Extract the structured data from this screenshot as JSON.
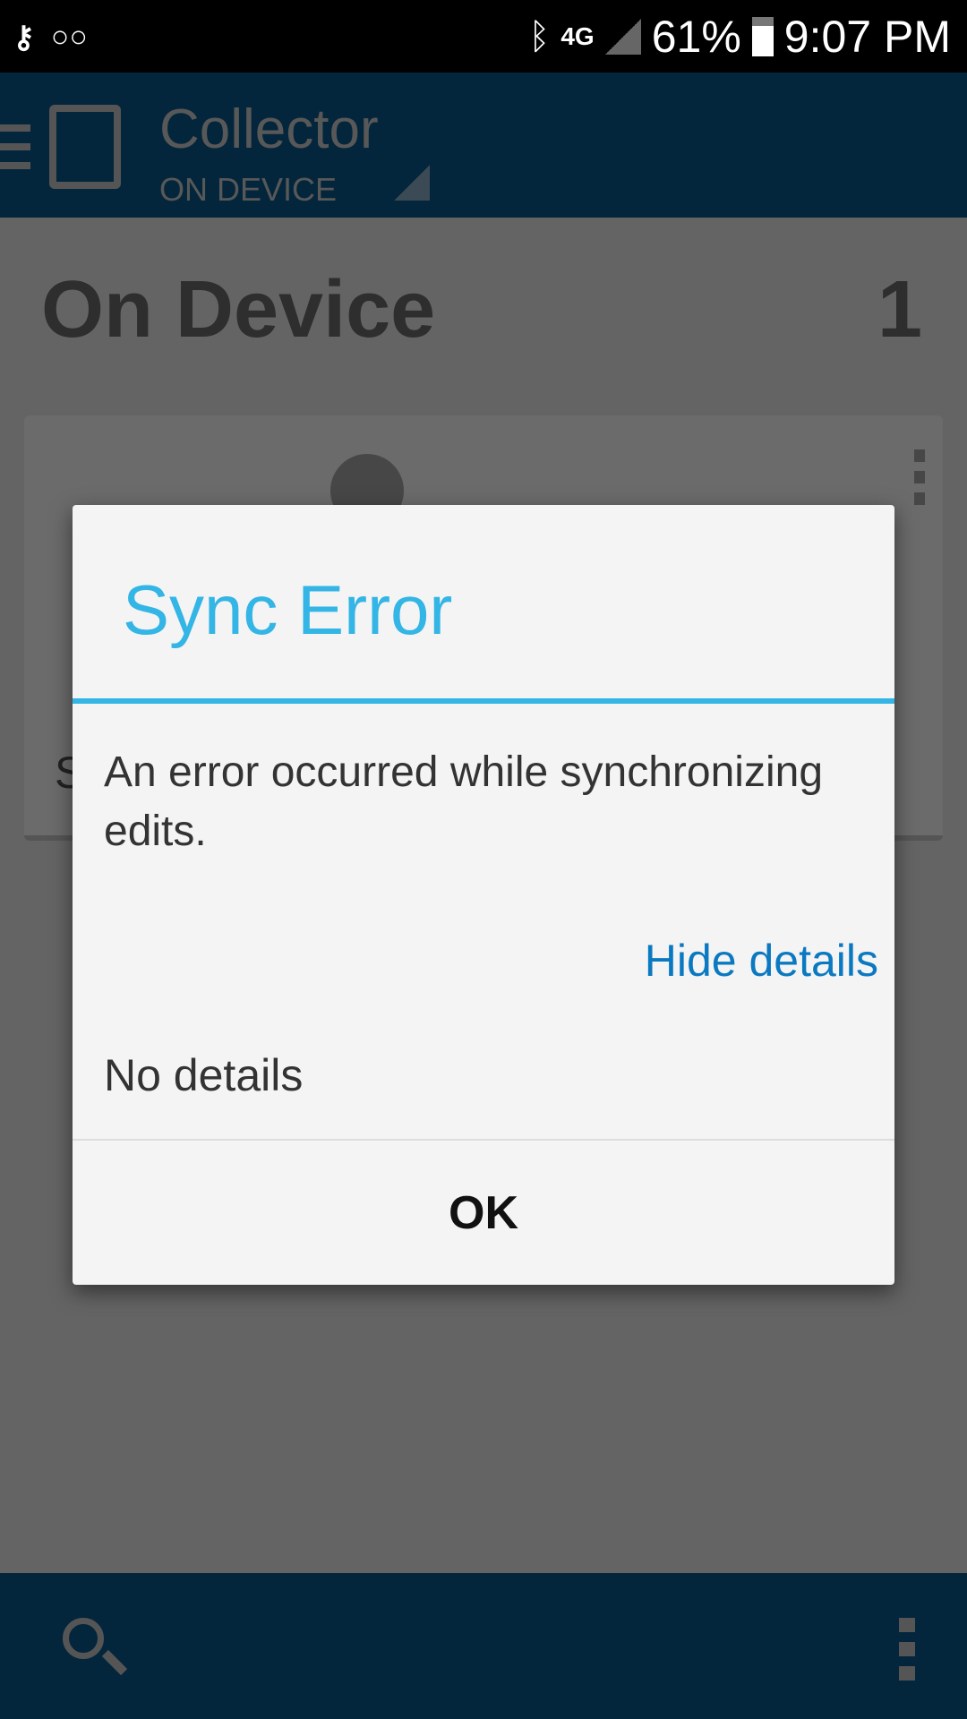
{
  "status_bar": {
    "battery": "61%",
    "time": "9:07 PM",
    "network": "4G"
  },
  "toolbar": {
    "title": "Collector",
    "subtitle": "ON DEVICE"
  },
  "main": {
    "heading": "On Device",
    "count": "1",
    "card_partial_text": "S"
  },
  "dialog": {
    "title": "Sync Error",
    "message": "An error occurred while synchronizing edits.",
    "toggle_link": "Hide details",
    "details": "No details",
    "ok_label": "OK"
  },
  "colors": {
    "accent": "#33b5e5",
    "link": "#0b79c1",
    "toolbar": "#03263c"
  }
}
